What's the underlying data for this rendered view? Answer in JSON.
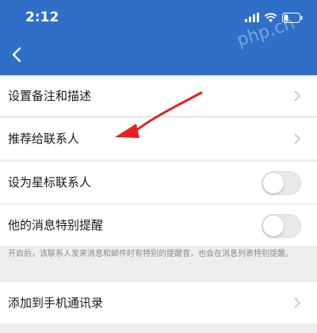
{
  "status_bar": {
    "time": "2:12",
    "icons": [
      "signal-icon",
      "wifi-icon",
      "battery-icon"
    ]
  },
  "nav": {
    "back_icon": "chevron-left-icon"
  },
  "colors": {
    "header_bg": "#2f6fc8",
    "page_bg": "#eeeeee",
    "arrow": "#e8201c"
  },
  "rows": {
    "set_remark": "设置备注和描述",
    "recommend": "推荐给联系人",
    "star": "设为星标联系人",
    "special_alert": "他的消息特别提醒",
    "add_to_contacts": "添加到手机通讯录"
  },
  "toggles": {
    "star_on": false,
    "special_alert_on": false
  },
  "hint": "开启后，该联系人发来消息和邮件时有特别的提醒音，也会在消息列表特别提醒。",
  "watermark": "php.cn"
}
